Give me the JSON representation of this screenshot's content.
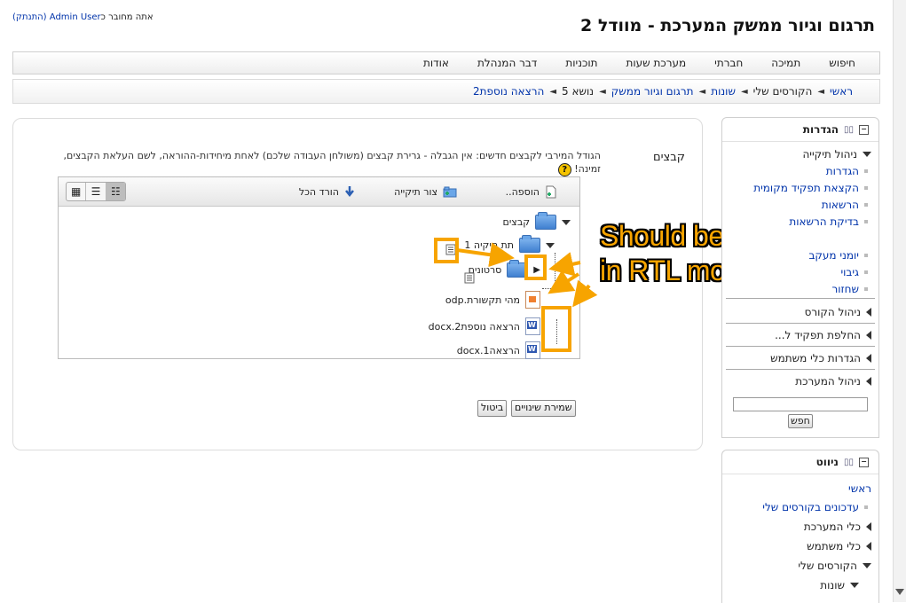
{
  "header": {
    "login_prefix": "אתה מחובר כ",
    "login_user": "Admin User",
    "logout_label": "(התנתק)",
    "site_title": "תרגום וגיור ממשק המערכת - מוודל 2"
  },
  "menu": {
    "items": [
      "חיפוש",
      "תמיכה",
      "חברתי",
      "מערכת שעות",
      "תוכניות",
      "דבר המנהלת",
      "אודות"
    ]
  },
  "breadcrumb": {
    "items": [
      "ראשי",
      "הקורסים שלי",
      "שונות",
      "תרגום וגיור ממשק",
      "נושא 5",
      "הרצאה נוספת2"
    ]
  },
  "filemanager": {
    "files_label": "קבצים",
    "maxsize_note": "הגודל המירבי לקבצים חדשים: אין הגבלה - גרירת קבצים (משולחן העבודה שלכם) לאחת מיחידות-ההוראה, לשם העלאת הקבצים, זמינה!",
    "help_icon": "?",
    "toolbar": {
      "add_label": "הוספה..",
      "create_folder_label": "צור תיקייה",
      "download_all_label": "הורד הכל"
    },
    "tree": {
      "root_folder": "קבצים",
      "subfolder": "תת תיקיה 1",
      "subsubfolder": "סרטונים",
      "file1": "מהי תקשורת.odp",
      "file2": "הרצאה נוספת2.docx",
      "file3": "הרצאה1.docx"
    },
    "save_label": "שמירת שינויים",
    "cancel_label": "ביטול"
  },
  "annotation": {
    "text_line1": "Should be inverted,",
    "text_line2": "in RTL mode",
    "color": "#f7a400"
  },
  "settings_block": {
    "title": "הגדרות",
    "course_admin": "ניהול תיקייה",
    "sub_items": [
      "הגדרות",
      "הקצאת תפקיד מקומית",
      "הרשאות",
      "בדיקת הרשאות",
      "יומני מעקב",
      "גיבוי",
      "שחזור"
    ],
    "collapsed": [
      "ניהול הקורס",
      "החלפת תפקיד ל...",
      "הגדרות כלי משתמש",
      "ניהול המערכת"
    ],
    "search_button": "חפש"
  },
  "nav_block": {
    "title": "ניווט",
    "home": "ראשי",
    "updates": "עדכונים בקורסים שלי",
    "site_tools": "כלי המערכת",
    "user_tools": "כלי משתמש",
    "my_courses": "הקורסים שלי",
    "misc": "שונות"
  }
}
